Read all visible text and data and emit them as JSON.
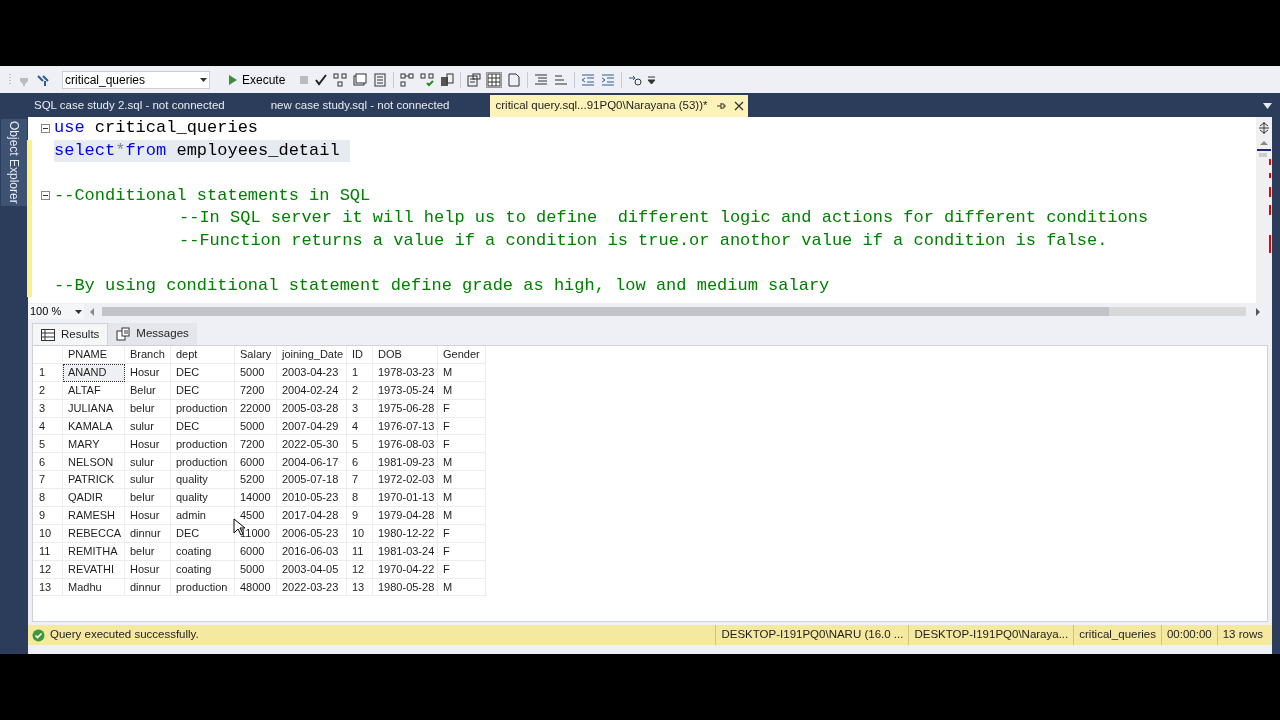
{
  "toolbar": {
    "database": "critical_queries",
    "execute": "Execute"
  },
  "document_tabs": [
    {
      "label": "SQL case study 2.sql - not connected",
      "selected": false
    },
    {
      "label": "new case study.sql - not connected",
      "selected": false
    },
    {
      "label": "critical query.sql...91PQ0\\Narayana (53))*",
      "selected": true
    }
  ],
  "side_panel": {
    "title": "Object Explorer"
  },
  "editor": {
    "lines": [
      {
        "kind": "code",
        "collapsible": true,
        "current": false,
        "changed": false,
        "indented": false,
        "segments": [
          {
            "kind": "keyword",
            "text": "use"
          },
          {
            "kind": "identifier",
            "text": " critical_queries"
          }
        ]
      },
      {
        "kind": "code",
        "collapsible": false,
        "current": true,
        "changed": true,
        "indented": false,
        "segments": [
          {
            "kind": "keyword",
            "text": "select"
          },
          {
            "kind": "operator",
            "text": "*"
          },
          {
            "kind": "keyword",
            "text": "from"
          },
          {
            "kind": "identifier",
            "text": " employees_detail "
          }
        ]
      },
      {
        "kind": "blank",
        "changed": true
      },
      {
        "kind": "code",
        "collapsible": true,
        "current": false,
        "changed": true,
        "indented": false,
        "segments": [
          {
            "kind": "comment",
            "text": "--Conditional statements in SQL"
          }
        ]
      },
      {
        "kind": "code",
        "collapsible": false,
        "current": false,
        "changed": true,
        "indented": true,
        "segments": [
          {
            "kind": "comment",
            "text": "--In SQL server it will help us to define  different logic and actions for different conditions"
          }
        ]
      },
      {
        "kind": "code",
        "collapsible": false,
        "current": false,
        "changed": true,
        "indented": true,
        "segments": [
          {
            "kind": "comment",
            "text": "--Function returns a value if a condition is true.or anothor value if a condition is false."
          }
        ]
      },
      {
        "kind": "blank",
        "changed": true
      },
      {
        "kind": "code",
        "collapsible": false,
        "current": false,
        "changed": true,
        "indented": false,
        "segments": [
          {
            "kind": "comment",
            "text": "--By using conditional statement define grade as high, low and medium salary"
          }
        ]
      }
    ],
    "zoom": "100 %"
  },
  "results": {
    "tabs": [
      {
        "label": "Results",
        "kind": "grid",
        "selected": true
      },
      {
        "label": "Messages",
        "kind": "messages",
        "selected": false
      }
    ],
    "columns": [
      "PNAME",
      "Branch",
      "dept",
      "Salary",
      "joining_Date",
      "ID",
      "DOB",
      "Gender"
    ],
    "rows": [
      {
        "number": "1",
        "focused": true,
        "cells": [
          "ANAND",
          "Hosur",
          "DEC",
          "5000",
          "2003-04-23",
          "1",
          "1978-03-23",
          "M"
        ]
      },
      {
        "number": "2",
        "focused": false,
        "cells": [
          "ALTAF",
          "Belur",
          "DEC",
          "7200",
          "2004-02-24",
          "2",
          "1973-05-24",
          "M"
        ]
      },
      {
        "number": "3",
        "focused": false,
        "cells": [
          "JULIANA",
          "belur",
          "production",
          "22000",
          "2005-03-28",
          "3",
          "1975-06-28",
          "F"
        ]
      },
      {
        "number": "4",
        "focused": false,
        "cells": [
          "KAMALA",
          "sulur",
          "DEC",
          "5000",
          "2007-04-29",
          "4",
          "1976-07-13",
          "F"
        ]
      },
      {
        "number": "5",
        "focused": false,
        "cells": [
          "MARY",
          "Hosur",
          "production",
          "7200",
          "2022-05-30",
          "5",
          "1976-08-03",
          "F"
        ]
      },
      {
        "number": "6",
        "focused": false,
        "cells": [
          "NELSON",
          "sulur",
          "production",
          "6000",
          "2004-06-17",
          "6",
          "1981-09-23",
          "M"
        ]
      },
      {
        "number": "7",
        "focused": false,
        "cells": [
          "PATRICK",
          "sulur",
          "quality",
          "5200",
          "2005-07-18",
          "7",
          "1972-02-03",
          "M"
        ]
      },
      {
        "number": "8",
        "focused": false,
        "cells": [
          "QADIR",
          "belur",
          "quality",
          "14000",
          "2010-05-23",
          "8",
          "1970-01-13",
          "M"
        ]
      },
      {
        "number": "9",
        "focused": false,
        "cells": [
          "RAMESH",
          "Hosur",
          "admin",
          "4500",
          "2017-04-28",
          "9",
          "1979-04-28",
          "M"
        ]
      },
      {
        "number": "10",
        "focused": false,
        "cells": [
          "REBECCA",
          "dinnur",
          "DEC",
          "11000",
          "2006-05-23",
          "10",
          "1980-12-22",
          "F"
        ]
      },
      {
        "number": "11",
        "focused": false,
        "cells": [
          "REMITHA",
          "belur",
          "coating",
          "6000",
          "2016-06-03",
          "11",
          "1981-03-24",
          "F"
        ]
      },
      {
        "number": "12",
        "focused": false,
        "cells": [
          "REVATHI",
          "Hosur",
          "coating",
          "5000",
          "2003-04-05",
          "12",
          "1970-04-22",
          "F"
        ]
      },
      {
        "number": "13",
        "focused": false,
        "cells": [
          "Madhu",
          "dinnur",
          "production",
          "48000",
          "2022-03-23",
          "13",
          "1980-05-28",
          "M"
        ]
      }
    ]
  },
  "status_bar": {
    "message": "Query executed successfully.",
    "items": [
      "DESKTOP-I191PQ0\\NARU (16.0 ...",
      "DESKTOP-I191PQ0\\Naraya...",
      "critical_queries",
      "00:00:00",
      "13 rows"
    ]
  }
}
